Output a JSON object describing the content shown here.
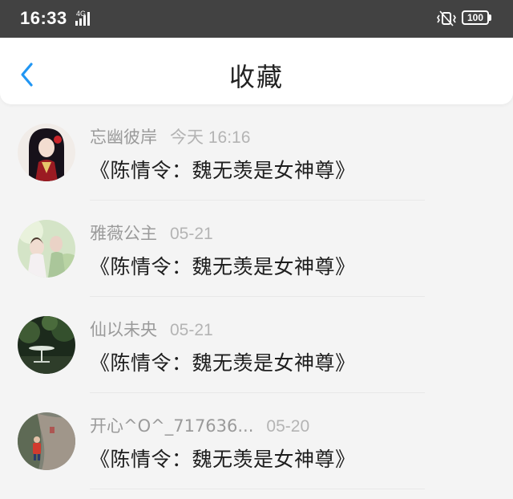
{
  "status_bar": {
    "time": "16:33",
    "network": "4G",
    "battery": "100",
    "icons": [
      "signal-icon",
      "vibrate-icon",
      "battery-icon"
    ]
  },
  "header": {
    "title": "收藏",
    "back_icon": "chevron-left-icon",
    "accent_color": "#2196f3"
  },
  "favorites": [
    {
      "user": "忘幽彼岸",
      "date": "今天 16:16",
      "title": "《陈情令：魏无羡是女神尊》"
    },
    {
      "user": "雅薇公主",
      "date": "05-21",
      "title": "《陈情令：魏无羡是女神尊》"
    },
    {
      "user": "仙以未央",
      "date": "05-21",
      "title": "《陈情令：魏无羡是女神尊》"
    },
    {
      "user": "开心^O^_717636...",
      "date": "05-20",
      "title": "《陈情令：魏无羡是女神尊》"
    }
  ]
}
